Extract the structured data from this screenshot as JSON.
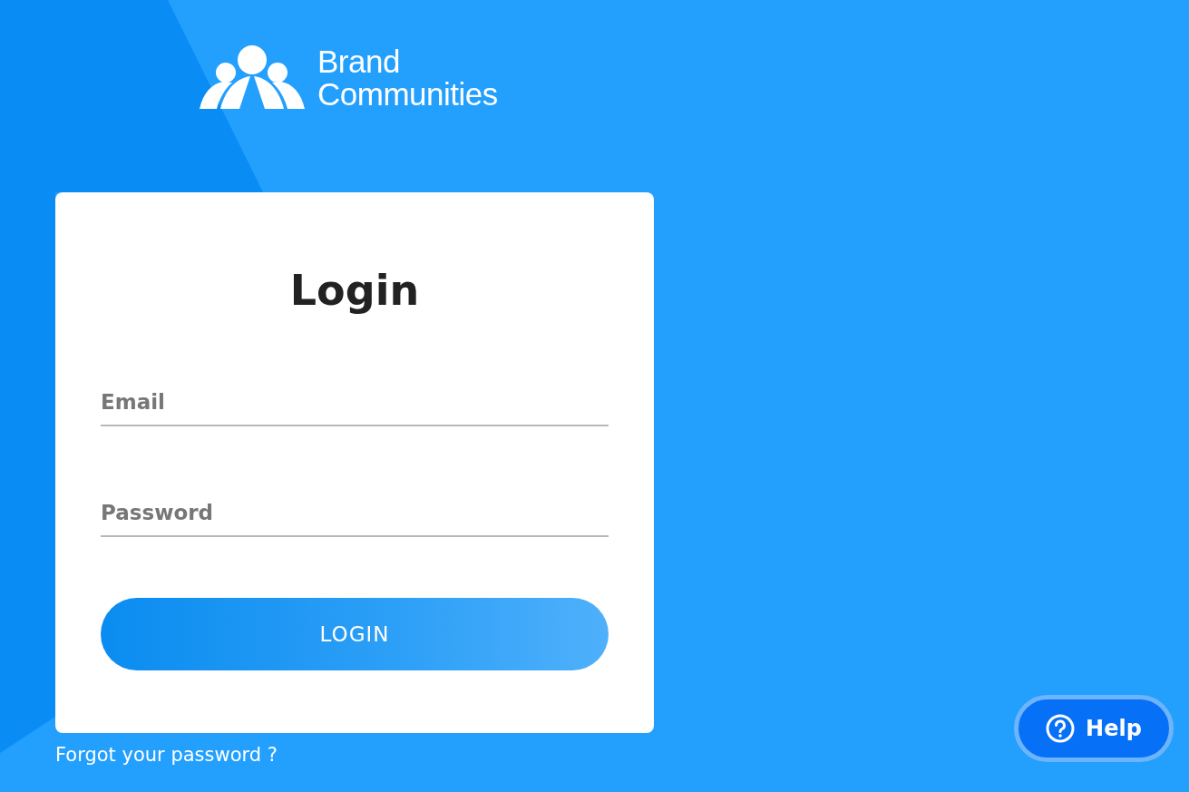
{
  "logo": {
    "line_1": "Brand",
    "line_2": "Communities"
  },
  "login_card": {
    "title": "Login",
    "fields": [
      {
        "placeholder": "Email"
      },
      {
        "placeholder": "Password"
      }
    ],
    "submit_button": "LOGIN"
  },
  "forgot_password_link": "Forgot your password ?",
  "help_button": "Help"
}
